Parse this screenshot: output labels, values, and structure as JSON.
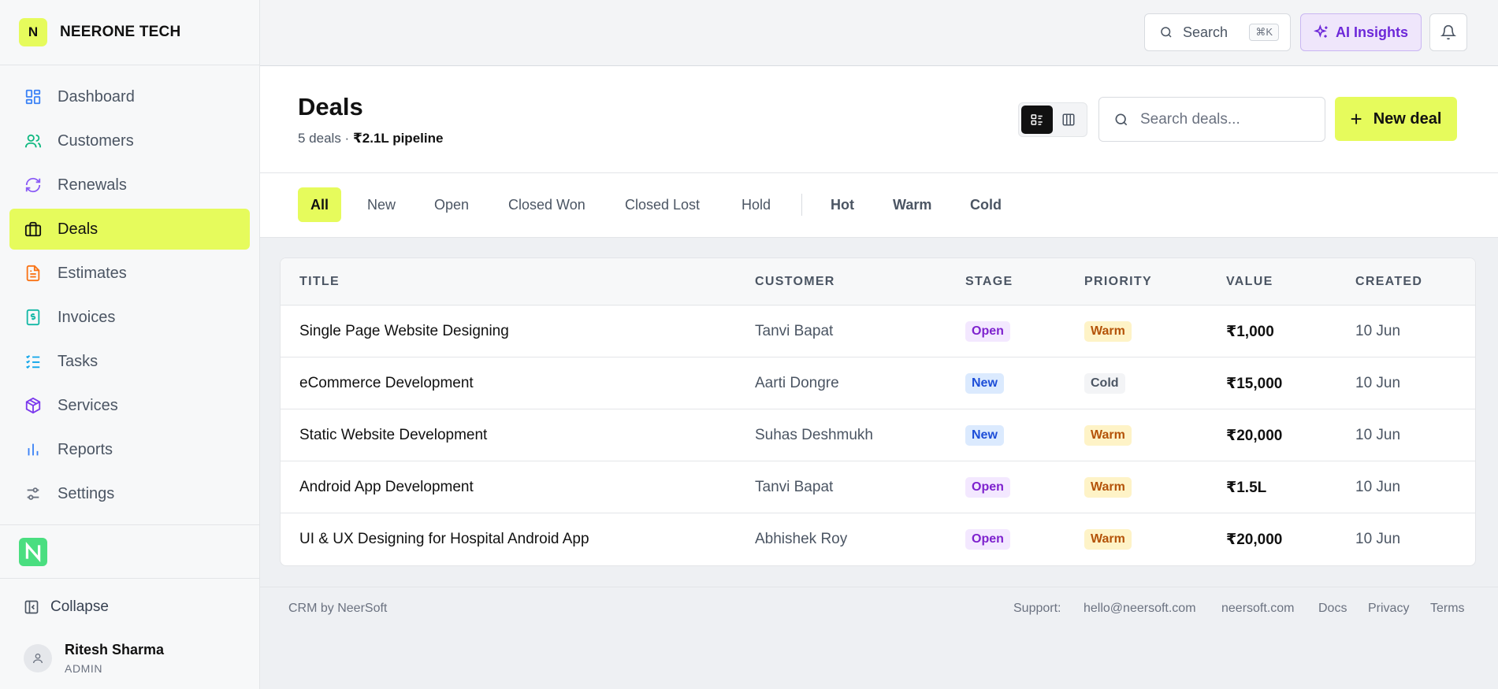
{
  "sidebar": {
    "brand_initial": "N",
    "brand_name": "NEERONE TECH",
    "items": [
      {
        "label": "Dashboard"
      },
      {
        "label": "Customers"
      },
      {
        "label": "Renewals"
      },
      {
        "label": "Deals"
      },
      {
        "label": "Estimates"
      },
      {
        "label": "Invoices"
      },
      {
        "label": "Tasks"
      },
      {
        "label": "Services"
      },
      {
        "label": "Reports"
      },
      {
        "label": "Settings"
      }
    ],
    "collapse_label": "Collapse",
    "user": {
      "name": "Ritesh Sharma",
      "role": "ADMIN"
    }
  },
  "topbar": {
    "search_label": "Search",
    "search_shortcut": "⌘K",
    "ai_label": "AI Insights"
  },
  "header": {
    "title": "Deals",
    "count": "5 deals",
    "separator": " · ",
    "pipeline": "₹2.1L pipeline",
    "search_placeholder": "Search deals...",
    "new_deal_label": "New deal"
  },
  "filters": [
    "All",
    "New",
    "Open",
    "Closed Won",
    "Closed Lost",
    "Hold",
    "Hot",
    "Warm",
    "Cold"
  ],
  "table": {
    "columns": [
      "TITLE",
      "CUSTOMER",
      "STAGE",
      "PRIORITY",
      "VALUE",
      "CREATED"
    ],
    "rows": [
      {
        "title": "Single Page Website Designing",
        "customer": "Tanvi Bapat",
        "stage": "Open",
        "priority": "Warm",
        "value": "₹1,000",
        "created": "10 Jun"
      },
      {
        "title": "eCommerce Development",
        "customer": "Aarti Dongre",
        "stage": "New",
        "priority": "Cold",
        "value": "₹15,000",
        "created": "10 Jun"
      },
      {
        "title": "Static Website Development",
        "customer": "Suhas Deshmukh",
        "stage": "New",
        "priority": "Warm",
        "value": "₹20,000",
        "created": "10 Jun"
      },
      {
        "title": "Android App Development",
        "customer": "Tanvi Bapat",
        "stage": "Open",
        "priority": "Warm",
        "value": "₹1.5L",
        "created": "10 Jun"
      },
      {
        "title": "UI & UX Designing for Hospital Android App",
        "customer": "Abhishek Roy",
        "stage": "Open",
        "priority": "Warm",
        "value": "₹20,000",
        "created": "10 Jun"
      }
    ]
  },
  "footer": {
    "left": "CRM by NeerSoft",
    "support_label": "Support:",
    "email": "hello@neersoft.com",
    "site": "neersoft.com",
    "docs": "Docs",
    "privacy": "Privacy",
    "terms": "Terms"
  },
  "colors": {
    "accent": "#e6fb5c",
    "ai": "#6d28d9"
  }
}
